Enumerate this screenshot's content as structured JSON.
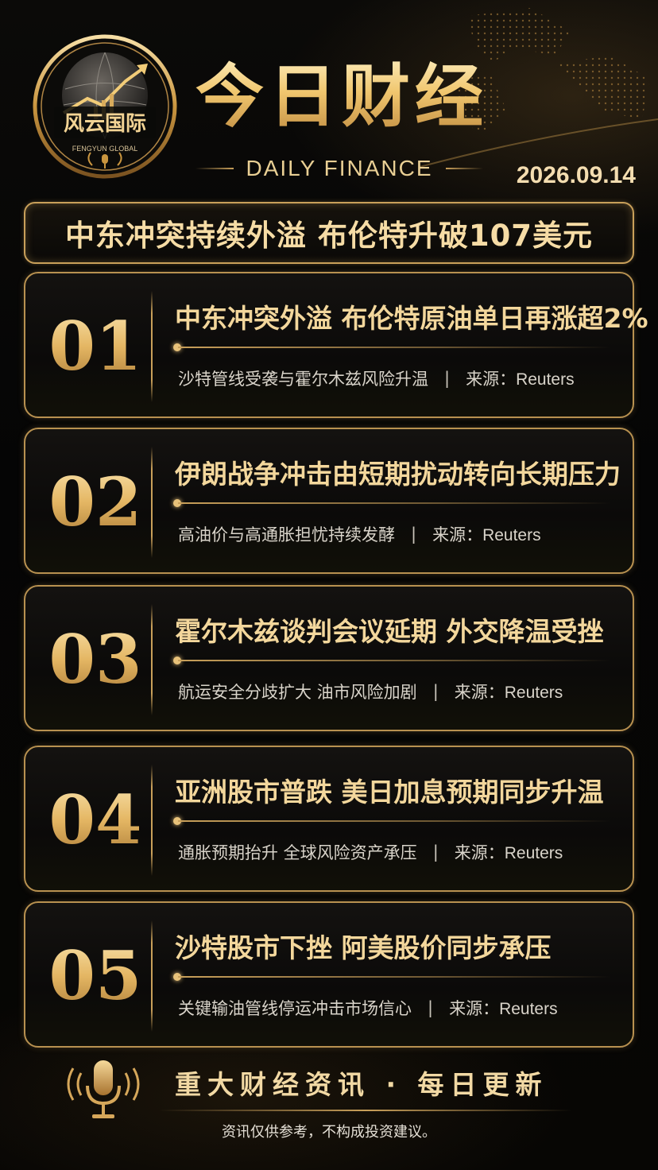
{
  "brand": {
    "name_cn": "风云国际",
    "name_en": "FENGYUN GLOBAL"
  },
  "header": {
    "title": "今日财经",
    "subtitle": "DAILY FINANCE",
    "date": "2026.09.14"
  },
  "banner": {
    "headline": "中东冲突持续外溢 布伦特升破107美元"
  },
  "news": [
    {
      "num": "01",
      "headline": "中东冲突外溢 布伦特原油单日再涨超2%",
      "summary": "沙特管线受袭与霍尔木兹风险升温",
      "source_label": "来源：",
      "source": "Reuters"
    },
    {
      "num": "02",
      "headline": "伊朗战争冲击由短期扰动转向长期压力",
      "summary": "高油价与高通胀担忧持续发酵",
      "source_label": "来源：",
      "source": "Reuters"
    },
    {
      "num": "03",
      "headline": "霍尔木兹谈判会议延期 外交降温受挫",
      "summary": "航运安全分歧扩大 油市风险加剧",
      "source_label": "来源：",
      "source": "Reuters"
    },
    {
      "num": "04",
      "headline": "亚洲股市普跌 美日加息预期同步升温",
      "summary": "通胀预期抬升 全球风险资产承压",
      "source_label": "来源：",
      "source": "Reuters"
    },
    {
      "num": "05",
      "headline": "沙特股市下挫 阿美股价同步承压",
      "summary": "关键输油管线停运冲击市场信心",
      "source_label": "来源：",
      "source": "Reuters"
    }
  ],
  "footer": {
    "tagline": "重大财经资讯 · 每日更新",
    "disclaimer": "资讯仅供参考，不构成投资建议。"
  },
  "colors": {
    "gold": "#c9a05a",
    "gold_light": "#f3d79c",
    "background": "#050505"
  },
  "icons": {
    "logo": "globe-chart-logo",
    "footer": "microphone-icon"
  }
}
